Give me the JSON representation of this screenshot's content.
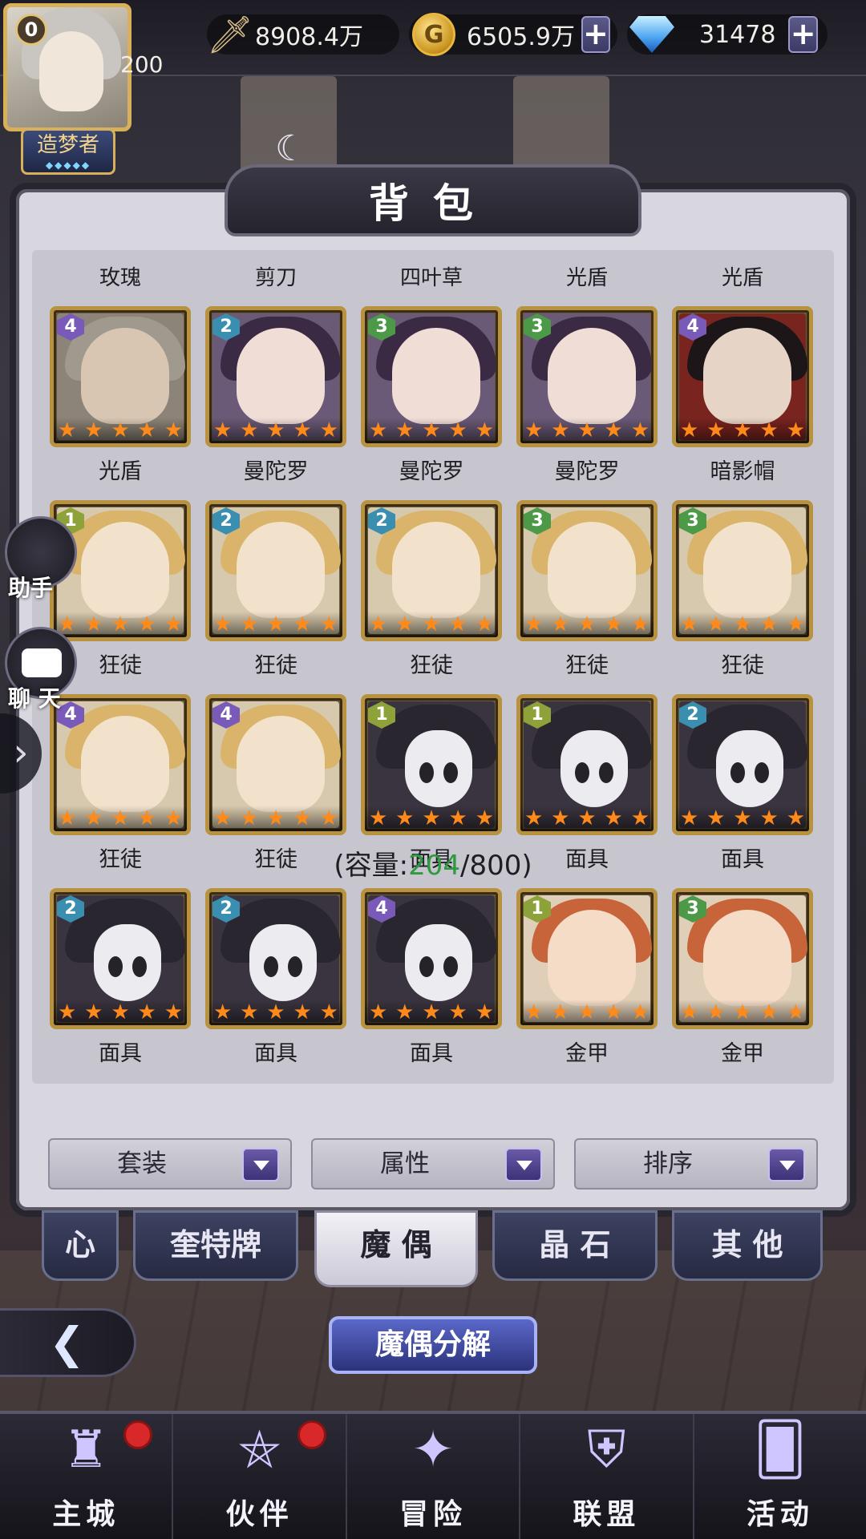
{
  "resources": {
    "power": "8908.4万",
    "gold": "6505.9万",
    "diamonds": "31478"
  },
  "player": {
    "rank": "0",
    "level": "200",
    "title": "造梦者"
  },
  "panel": {
    "title": "背包"
  },
  "column_labels": [
    "玫瑰",
    "剪刀",
    "四叶草",
    "光盾",
    "光盾"
  ],
  "items": [
    {
      "name": "光盾",
      "rank": "4",
      "kind": "soldier",
      "stars": 5
    },
    {
      "name": "曼陀罗",
      "rank": "2",
      "kind": "girl",
      "stars": 5
    },
    {
      "name": "曼陀罗",
      "rank": "3",
      "kind": "girl",
      "stars": 5
    },
    {
      "name": "曼陀罗",
      "rank": "3",
      "kind": "girl",
      "stars": 5
    },
    {
      "name": "暗影帽",
      "rank": "4",
      "kind": "hat",
      "stars": 5
    },
    {
      "name": "狂徒",
      "rank": "1",
      "kind": "blond",
      "stars": 5
    },
    {
      "name": "狂徒",
      "rank": "2",
      "kind": "blond",
      "stars": 5
    },
    {
      "name": "狂徒",
      "rank": "2",
      "kind": "blond",
      "stars": 5
    },
    {
      "name": "狂徒",
      "rank": "3",
      "kind": "blond",
      "stars": 5
    },
    {
      "name": "狂徒",
      "rank": "3",
      "kind": "blond",
      "stars": 5
    },
    {
      "name": "狂徒",
      "rank": "4",
      "kind": "blond",
      "stars": 5
    },
    {
      "name": "狂徒",
      "rank": "4",
      "kind": "blond",
      "stars": 5
    },
    {
      "name": "面具",
      "rank": "1",
      "kind": "mask",
      "stars": 5
    },
    {
      "name": "面具",
      "rank": "1",
      "kind": "mask",
      "stars": 5
    },
    {
      "name": "面具",
      "rank": "2",
      "kind": "mask",
      "stars": 5
    },
    {
      "name": "面具",
      "rank": "2",
      "kind": "mask",
      "stars": 5
    },
    {
      "name": "面具",
      "rank": "2",
      "kind": "mask",
      "stars": 5
    },
    {
      "name": "面具",
      "rank": "4",
      "kind": "mask",
      "stars": 5
    },
    {
      "name": "金甲",
      "rank": "1",
      "kind": "redhair",
      "stars": 5
    },
    {
      "name": "金甲",
      "rank": "3",
      "kind": "redhair",
      "stars": 5
    }
  ],
  "capacity": {
    "open": "(容量:",
    "used": "204",
    "rest": "/800)"
  },
  "filters": [
    "套装",
    "属性",
    "排序"
  ],
  "tabs": [
    "心",
    "奎特牌",
    "魔 偶",
    "晶 石",
    "其 他"
  ],
  "active_tab": 2,
  "actions": {
    "decompose": "魔偶分解"
  },
  "side": {
    "assistant": "助手",
    "chat": "聊 天"
  },
  "nav": [
    {
      "label": "主城",
      "icon": "castle-icon",
      "badge": true
    },
    {
      "label": "伙伴",
      "icon": "witch-hat-icon",
      "badge": true
    },
    {
      "label": "冒险",
      "icon": "star-portal-icon",
      "badge": false
    },
    {
      "label": "联盟",
      "icon": "shield-icon",
      "badge": false
    },
    {
      "label": "活动",
      "icon": "cards-icon",
      "badge": false
    }
  ],
  "colors": {
    "accent_gold": "#d8b05a",
    "capacity_green": "#2f9a3e",
    "star_orange": "#ff8a1a",
    "badge_red": "#d8282a"
  }
}
